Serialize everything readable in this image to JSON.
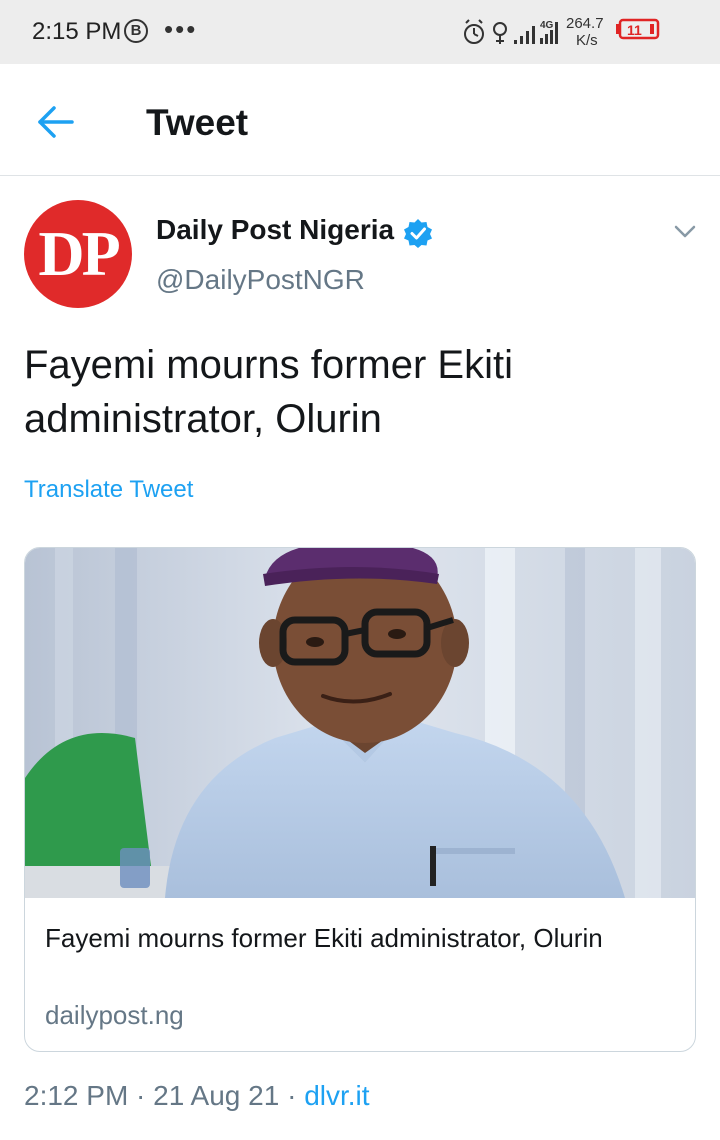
{
  "status_bar": {
    "time": "2:15 PM",
    "b_badge": "B",
    "dots": "•••",
    "network_4g": "4G",
    "speed_value": "264.7",
    "speed_unit": "K/s",
    "battery": "11",
    "battery_color": "#e02424"
  },
  "header": {
    "title": "Tweet",
    "back_icon": "arrow-left-icon",
    "accent": "#1da1f2"
  },
  "tweet": {
    "avatar_text": "DP",
    "avatar_color": "#e02a2a",
    "author_name": "Daily Post Nigeria",
    "verified_icon": "verified-badge-icon",
    "handle": "@DailyPostNGR",
    "menu_icon": "chevron-down-icon",
    "text": "Fayemi mourns former Ekiti administrator, Olurin",
    "translate": "Translate Tweet",
    "card": {
      "title": "Fayemi mourns former Ekiti administrator, Olurin",
      "domain": "dailypost.ng"
    },
    "time": "2:12 PM",
    "separator1": " · ",
    "date": "21 Aug 21",
    "separator2": " · ",
    "source": "dlvr.it"
  }
}
